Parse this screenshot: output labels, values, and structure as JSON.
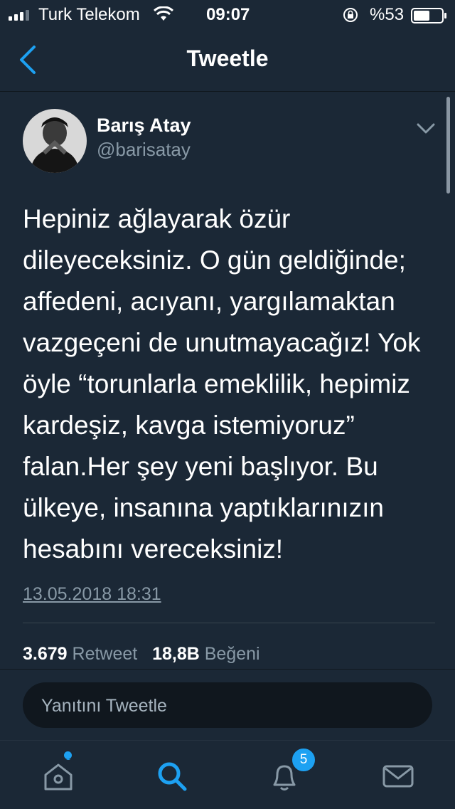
{
  "status_bar": {
    "carrier": "Turk Telekom",
    "time": "09:07",
    "battery": "%53"
  },
  "nav": {
    "title": "Tweetle",
    "back_icon": "chevron-left-icon"
  },
  "tweet": {
    "author_name": "Barış Atay",
    "author_handle": "@barisatay",
    "text_lines": [
      "Hepiniz ağlayarak özür",
      "dileyeceksiniz. O gün geldiğinde;",
      "affedeni, acıyanı, yargılamaktan",
      "vazgeçeni de unutmayacağız! Yok",
      "öyle “torunlarla emeklilik, hepimiz",
      "kardeşiz, kavga istemiyoruz”",
      "falan.Her şey yeni başlıyor. Bu",
      "ülkeye, insanına yaptıklarınızın",
      "hesabını vereceksiniz!"
    ],
    "timestamp": "13.05.2018 18:31",
    "retweet_count": "3.679",
    "retweet_label": "Retweet",
    "like_count": "18,8B",
    "like_label": "Beğeni"
  },
  "reply": {
    "placeholder": "Yanıtını Tweetle"
  },
  "tab_bar": {
    "items": [
      {
        "icon": "home-icon",
        "active": false,
        "has_dot": true
      },
      {
        "icon": "search-icon",
        "active": true
      },
      {
        "icon": "bell-icon",
        "active": false
      },
      {
        "icon": "mail-icon",
        "active": false
      }
    ],
    "notification_badge": "5"
  },
  "colors": {
    "background": "#1b2836",
    "accent": "#1da1f2",
    "muted_text": "#8899a6"
  }
}
